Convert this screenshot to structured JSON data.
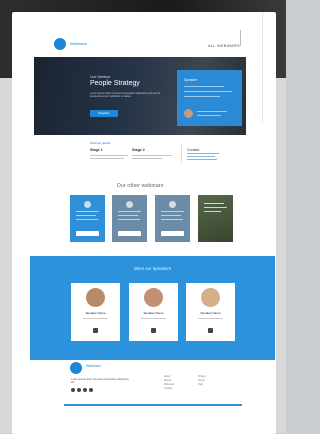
{
  "header": {
    "logo_text": "Webinars",
    "nav_link": "ALL WEBINARS"
  },
  "hero": {
    "tag": "Live Webinar",
    "title": "People Strategy",
    "description": "Lorem ipsum dolor sit amet consectetur adipiscing elit sed do eiusmod tempor incididunt ut labore",
    "button": "Register",
    "speaker_heading": "Speaker"
  },
  "info": {
    "section_label": "Webinar details",
    "col1_title": "Stage 1",
    "col2_title": "Stage 2",
    "col3_title": "Contact"
  },
  "webinars": {
    "title": "Our other webinars",
    "cards": [
      {
        "color": "#2f8fd8"
      },
      {
        "color": "#6b8ba6"
      },
      {
        "color": "#6b8ba6"
      },
      {
        "color": "#4b5c3f"
      }
    ]
  },
  "speakers": {
    "title": "Meet our speakers",
    "people": [
      {
        "name": "Speaker Name"
      },
      {
        "name": "Speaker Name"
      },
      {
        "name": "Speaker Name"
      }
    ]
  },
  "footer": {
    "logo_text": "Webinars",
    "description": "Lorem ipsum dolor sit amet consectetur adipiscing elit",
    "links_col1": [
      "About",
      "Events",
      "Webinars",
      "Contact"
    ],
    "links_col2": [
      "Privacy",
      "Terms",
      "Help"
    ]
  },
  "colors": {
    "brand": "#1e88d8",
    "band": "#2d92dc"
  }
}
